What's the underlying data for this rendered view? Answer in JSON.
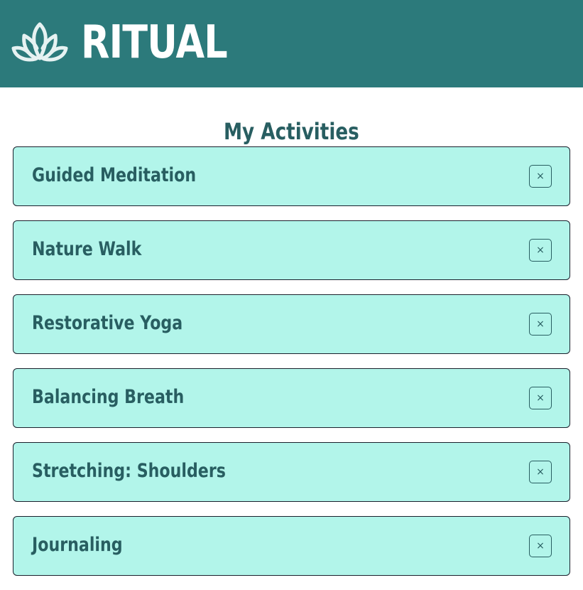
{
  "header": {
    "brand": "RITUAL",
    "logo_icon": "lotus-icon",
    "background_color": "#2c7a7b",
    "text_color": "#ffffff"
  },
  "main": {
    "title": "My Activities",
    "title_color": "#285e61",
    "activities": [
      {
        "label": "Guided Meditation",
        "remove_label": "×"
      },
      {
        "label": "Nature Walk",
        "remove_label": "×"
      },
      {
        "label": "Restorative Yoga",
        "remove_label": "×"
      },
      {
        "label": "Balancing Breath",
        "remove_label": "×"
      },
      {
        "label": "Stretching: Shoulders",
        "remove_label": "×"
      },
      {
        "label": "Journaling",
        "remove_label": "×"
      }
    ],
    "card_color": "#b2f5ea",
    "card_border_color": "#1a202c"
  }
}
